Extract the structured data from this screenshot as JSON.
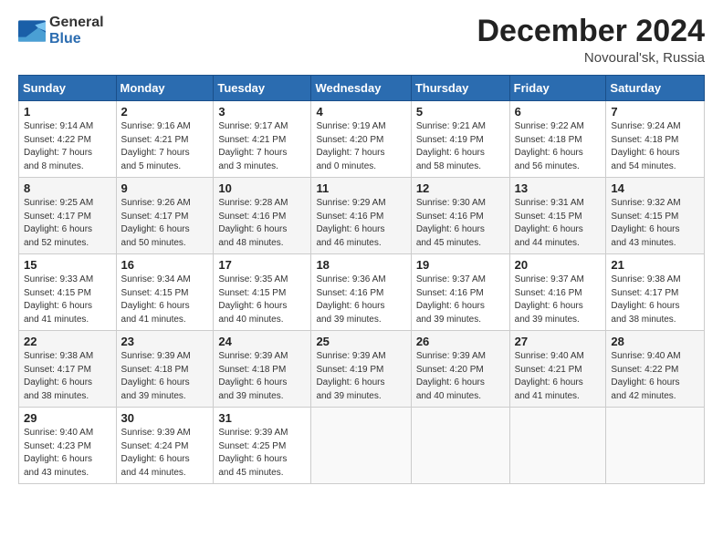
{
  "logo": {
    "general": "General",
    "blue": "Blue"
  },
  "title": "December 2024",
  "subtitle": "Novoural'sk, Russia",
  "headers": [
    "Sunday",
    "Monday",
    "Tuesday",
    "Wednesday",
    "Thursday",
    "Friday",
    "Saturday"
  ],
  "weeks": [
    [
      {
        "day": "1",
        "info": "Sunrise: 9:14 AM\nSunset: 4:22 PM\nDaylight: 7 hours\nand 8 minutes."
      },
      {
        "day": "2",
        "info": "Sunrise: 9:16 AM\nSunset: 4:21 PM\nDaylight: 7 hours\nand 5 minutes."
      },
      {
        "day": "3",
        "info": "Sunrise: 9:17 AM\nSunset: 4:21 PM\nDaylight: 7 hours\nand 3 minutes."
      },
      {
        "day": "4",
        "info": "Sunrise: 9:19 AM\nSunset: 4:20 PM\nDaylight: 7 hours\nand 0 minutes."
      },
      {
        "day": "5",
        "info": "Sunrise: 9:21 AM\nSunset: 4:19 PM\nDaylight: 6 hours\nand 58 minutes."
      },
      {
        "day": "6",
        "info": "Sunrise: 9:22 AM\nSunset: 4:18 PM\nDaylight: 6 hours\nand 56 minutes."
      },
      {
        "day": "7",
        "info": "Sunrise: 9:24 AM\nSunset: 4:18 PM\nDaylight: 6 hours\nand 54 minutes."
      }
    ],
    [
      {
        "day": "8",
        "info": "Sunrise: 9:25 AM\nSunset: 4:17 PM\nDaylight: 6 hours\nand 52 minutes."
      },
      {
        "day": "9",
        "info": "Sunrise: 9:26 AM\nSunset: 4:17 PM\nDaylight: 6 hours\nand 50 minutes."
      },
      {
        "day": "10",
        "info": "Sunrise: 9:28 AM\nSunset: 4:16 PM\nDaylight: 6 hours\nand 48 minutes."
      },
      {
        "day": "11",
        "info": "Sunrise: 9:29 AM\nSunset: 4:16 PM\nDaylight: 6 hours\nand 46 minutes."
      },
      {
        "day": "12",
        "info": "Sunrise: 9:30 AM\nSunset: 4:16 PM\nDaylight: 6 hours\nand 45 minutes."
      },
      {
        "day": "13",
        "info": "Sunrise: 9:31 AM\nSunset: 4:15 PM\nDaylight: 6 hours\nand 44 minutes."
      },
      {
        "day": "14",
        "info": "Sunrise: 9:32 AM\nSunset: 4:15 PM\nDaylight: 6 hours\nand 43 minutes."
      }
    ],
    [
      {
        "day": "15",
        "info": "Sunrise: 9:33 AM\nSunset: 4:15 PM\nDaylight: 6 hours\nand 41 minutes."
      },
      {
        "day": "16",
        "info": "Sunrise: 9:34 AM\nSunset: 4:15 PM\nDaylight: 6 hours\nand 41 minutes."
      },
      {
        "day": "17",
        "info": "Sunrise: 9:35 AM\nSunset: 4:15 PM\nDaylight: 6 hours\nand 40 minutes."
      },
      {
        "day": "18",
        "info": "Sunrise: 9:36 AM\nSunset: 4:16 PM\nDaylight: 6 hours\nand 39 minutes."
      },
      {
        "day": "19",
        "info": "Sunrise: 9:37 AM\nSunset: 4:16 PM\nDaylight: 6 hours\nand 39 minutes."
      },
      {
        "day": "20",
        "info": "Sunrise: 9:37 AM\nSunset: 4:16 PM\nDaylight: 6 hours\nand 39 minutes."
      },
      {
        "day": "21",
        "info": "Sunrise: 9:38 AM\nSunset: 4:17 PM\nDaylight: 6 hours\nand 38 minutes."
      }
    ],
    [
      {
        "day": "22",
        "info": "Sunrise: 9:38 AM\nSunset: 4:17 PM\nDaylight: 6 hours\nand 38 minutes."
      },
      {
        "day": "23",
        "info": "Sunrise: 9:39 AM\nSunset: 4:18 PM\nDaylight: 6 hours\nand 39 minutes."
      },
      {
        "day": "24",
        "info": "Sunrise: 9:39 AM\nSunset: 4:18 PM\nDaylight: 6 hours\nand 39 minutes."
      },
      {
        "day": "25",
        "info": "Sunrise: 9:39 AM\nSunset: 4:19 PM\nDaylight: 6 hours\nand 39 minutes."
      },
      {
        "day": "26",
        "info": "Sunrise: 9:39 AM\nSunset: 4:20 PM\nDaylight: 6 hours\nand 40 minutes."
      },
      {
        "day": "27",
        "info": "Sunrise: 9:40 AM\nSunset: 4:21 PM\nDaylight: 6 hours\nand 41 minutes."
      },
      {
        "day": "28",
        "info": "Sunrise: 9:40 AM\nSunset: 4:22 PM\nDaylight: 6 hours\nand 42 minutes."
      }
    ],
    [
      {
        "day": "29",
        "info": "Sunrise: 9:40 AM\nSunset: 4:23 PM\nDaylight: 6 hours\nand 43 minutes."
      },
      {
        "day": "30",
        "info": "Sunrise: 9:39 AM\nSunset: 4:24 PM\nDaylight: 6 hours\nand 44 minutes."
      },
      {
        "day": "31",
        "info": "Sunrise: 9:39 AM\nSunset: 4:25 PM\nDaylight: 6 hours\nand 45 minutes."
      },
      {
        "day": "",
        "info": ""
      },
      {
        "day": "",
        "info": ""
      },
      {
        "day": "",
        "info": ""
      },
      {
        "day": "",
        "info": ""
      }
    ]
  ]
}
